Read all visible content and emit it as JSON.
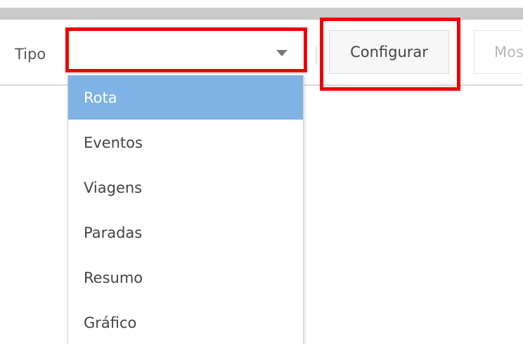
{
  "toolbar": {
    "type_label": "Tipo",
    "select_value": "",
    "configure_button": "Configurar",
    "show_button_partial": "Mos"
  },
  "dropdown": {
    "items": [
      {
        "label": "Rota",
        "selected": true
      },
      {
        "label": "Eventos",
        "selected": false
      },
      {
        "label": "Viagens",
        "selected": false
      },
      {
        "label": "Paradas",
        "selected": false
      },
      {
        "label": "Resumo",
        "selected": false
      },
      {
        "label": "Gráfico",
        "selected": false
      }
    ]
  },
  "colors": {
    "highlight_box": "#ee0000",
    "selected_item_bg": "#7fb2e5"
  }
}
